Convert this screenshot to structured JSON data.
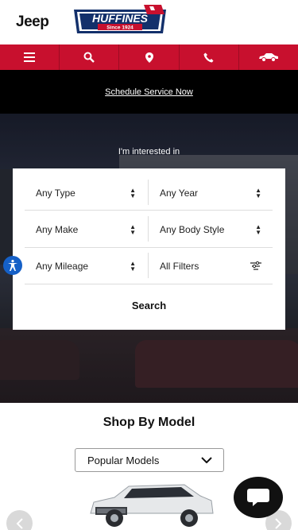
{
  "header": {
    "brand_logo": "Jeep",
    "dealer_name": "HUFFINES",
    "dealer_tagline": "Since 1924"
  },
  "nav": {
    "items": [
      {
        "icon": "menu-icon"
      },
      {
        "icon": "search-icon"
      },
      {
        "icon": "location-pin-icon"
      },
      {
        "icon": "phone-icon"
      },
      {
        "icon": "car-icon"
      }
    ]
  },
  "promo": {
    "link_text": "Schedule Service Now"
  },
  "hero": {
    "label": "I'm interested in",
    "filters": {
      "type": "Any Type",
      "year": "Any Year",
      "make": "Any Make",
      "body_style": "Any Body Style",
      "mileage": "Any Mileage",
      "all_filters": "All Filters"
    },
    "search_label": "Search"
  },
  "shop": {
    "title": "Shop By Model",
    "select_value": "Popular Models"
  },
  "colors": {
    "brand_red": "#c8102e",
    "promo_bg": "#000000",
    "accessibility_blue": "#1560c7"
  }
}
